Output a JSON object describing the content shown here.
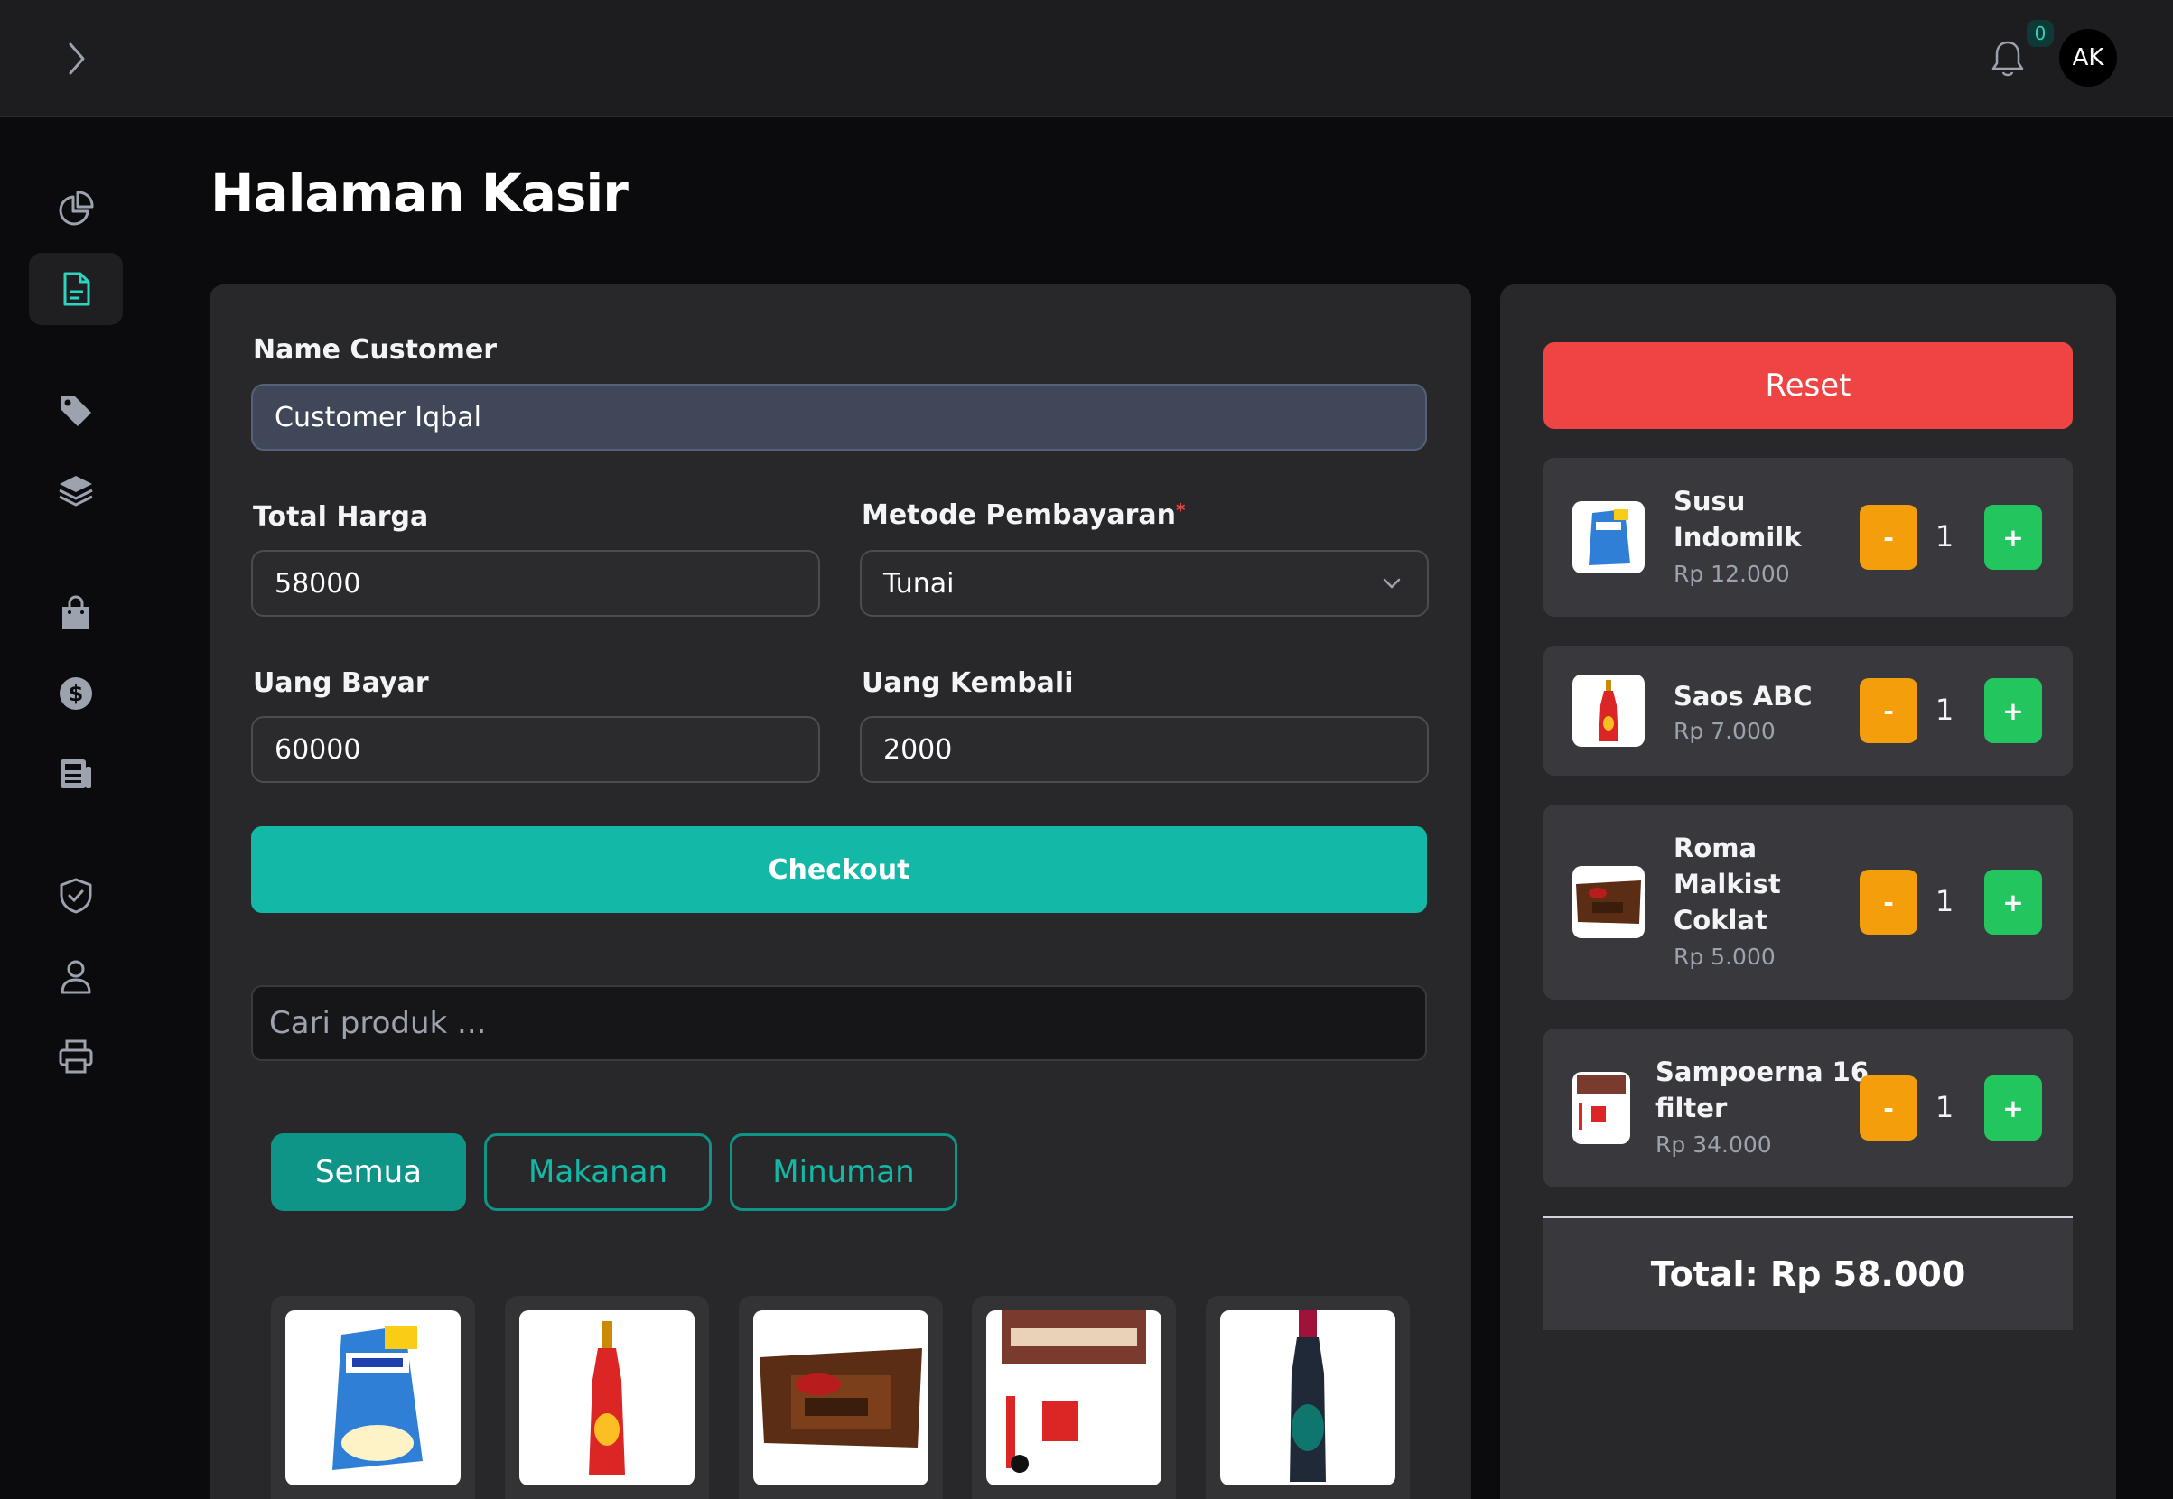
{
  "topbar": {
    "notification_count": "0",
    "avatar_initials": "AK"
  },
  "page": {
    "title": "Halaman Kasir"
  },
  "form": {
    "customer_label": "Name Customer",
    "customer_value": "Customer Iqbal",
    "total_label": "Total Harga",
    "total_value": "58000",
    "payment_label": "Metode Pembayaran",
    "payment_required": "*",
    "payment_value": "Tunai",
    "paid_label": "Uang Bayar",
    "paid_value": "60000",
    "change_label": "Uang Kembali",
    "change_value": "2000",
    "checkout_label": "Checkout"
  },
  "search": {
    "placeholder": "Cari produk ..."
  },
  "categories": [
    "Semua",
    "Makanan",
    "Minuman"
  ],
  "cart": {
    "reset_label": "Reset",
    "items": [
      {
        "name_l1": "Susu",
        "name_l2": "Indomilk",
        "name_l3": "",
        "price": "Rp 12.000",
        "qty": "1"
      },
      {
        "name_l1": "Saos ABC",
        "name_l2": "",
        "name_l3": "",
        "price": "Rp 7.000",
        "qty": "1"
      },
      {
        "name_l1": "Roma",
        "name_l2": "Malkist",
        "name_l3": "Coklat",
        "price": "Rp 5.000",
        "qty": "1"
      },
      {
        "name_l1": "Sampoerna 16",
        "name_l2": "filter",
        "name_l3": "",
        "price": "Rp 34.000",
        "qty": "1"
      }
    ],
    "minus_label": "-",
    "plus_label": "+",
    "total": "Total: Rp 58.000"
  },
  "colors": {
    "accent": "#14b8a6",
    "danger": "#ef4444",
    "warning": "#f59e0b",
    "success": "#22c55e"
  }
}
